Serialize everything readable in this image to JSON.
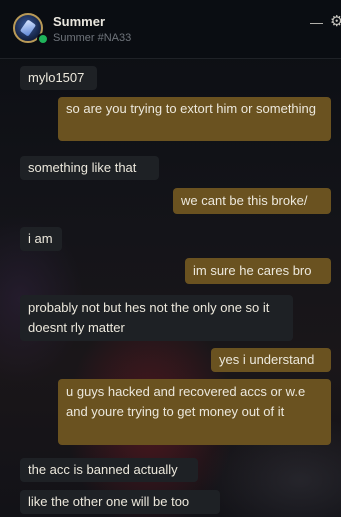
{
  "contact": {
    "name": "Summer",
    "riot_id": "Summer #NA33",
    "status": "online",
    "status_color": "#1fb35a"
  },
  "colors": {
    "incoming_bubble": "#1e2125",
    "outgoing_bubble": "#6a5220",
    "text": "#ece8dc"
  },
  "messages": [
    {
      "from": "them",
      "text": "mylo1507"
    },
    {
      "from": "me",
      "text": "so are you trying to extort him or something"
    },
    {
      "from": "them",
      "text": "something like that"
    },
    {
      "from": "me",
      "text": "we cant be this broke/"
    },
    {
      "from": "them",
      "text": "i am"
    },
    {
      "from": "me",
      "text": "im sure he cares bro"
    },
    {
      "from": "them",
      "text": "probably not but hes not the only one so it doesnt rly matter"
    },
    {
      "from": "me",
      "text": "yes i understand"
    },
    {
      "from": "me",
      "text": "u guys hacked and recovered accs or w.e and youre trying to get money out of it"
    },
    {
      "from": "them",
      "text": "the acc is banned actually"
    },
    {
      "from": "them",
      "text": "like the other one will be too"
    }
  ]
}
